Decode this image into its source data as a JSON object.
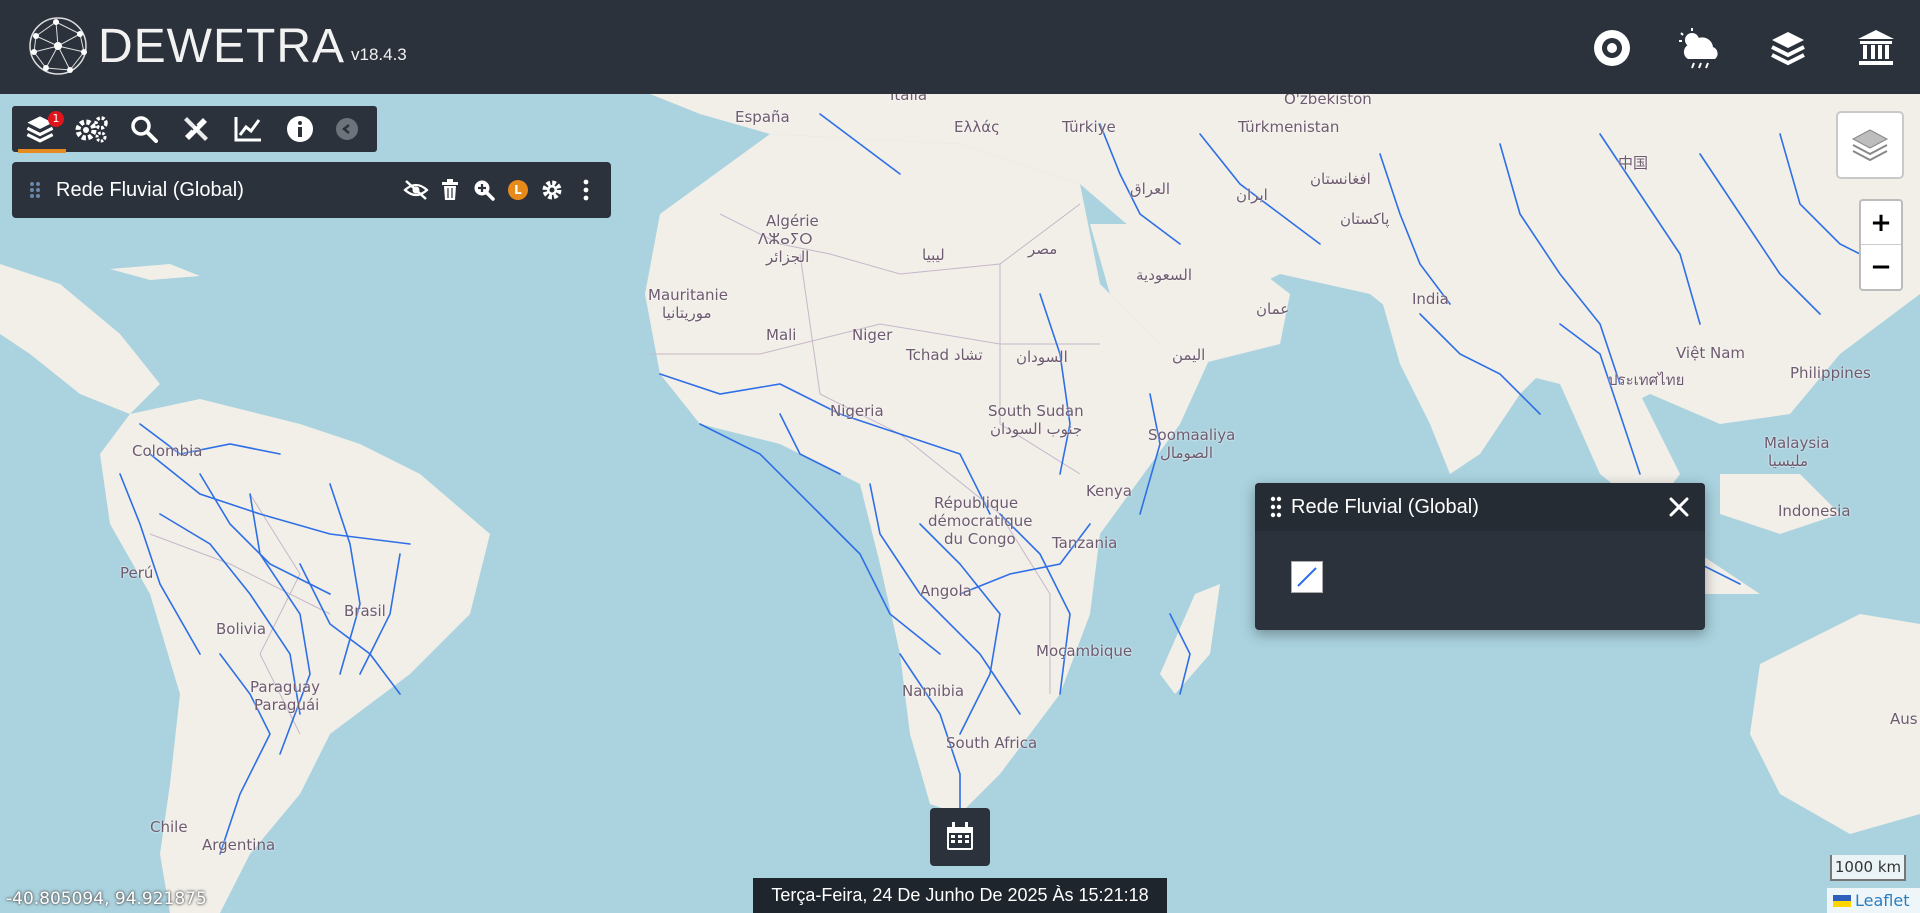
{
  "header": {
    "app_name": "DEWETRA",
    "version": "v18.4.3",
    "icons": [
      "eye-icon",
      "weather-storm-icon",
      "layers-icon",
      "bank-icon"
    ]
  },
  "toolbar": {
    "layers_badge": "1",
    "buttons": [
      "layers-icon",
      "gears-icon",
      "search-icon",
      "tools-icon",
      "chart-line-icon",
      "info-icon",
      "chevron-left-icon"
    ]
  },
  "layer_row": {
    "name": "Rede Fluvial (Global)",
    "badge": "L"
  },
  "legend": {
    "title": "Rede Fluvial (Global)"
  },
  "map": {
    "labels": [
      "Italia",
      "España",
      "Ελλάς",
      "Türkiye",
      "O'zbekiston",
      "Türkmenistan",
      "中国",
      "Algérie",
      "ⴷⵣⴰⵢⵔ",
      "الجزائر",
      "ليبيا",
      "مصر",
      "العراق",
      "ایران",
      "افغانستان",
      "پاکستان",
      "السعودية",
      "Mauritanie",
      "موريتانيا",
      "Mali",
      "Niger",
      "Tchad تشاد",
      "السودان",
      "اليمن",
      "عمان",
      "India",
      "Việt Nam",
      "Philippines",
      "ประเทศไทย",
      "Nigeria",
      "South Sudan",
      "جنوب السودان",
      "Soomaaliya",
      "الصومال",
      "Malaysia",
      "ملیسیا",
      "Colombia",
      "Kenya",
      "République",
      "démocratique",
      "du Congo",
      "Tanzania",
      "Indonesia",
      "Perú",
      "Brasil",
      "Angola",
      "Bolivia",
      "Moçambique",
      "Paraguay",
      "Paraguái",
      "Namibia",
      "South Africa",
      "Chile",
      "Argentina",
      "Aus"
    ]
  },
  "datetime": "Terça-Feira, 24 De Junho De 2025 Às 15:21:18",
  "coordinates": "-40.805094, 94.921875",
  "scale": "1000 km",
  "attribution": "Leaflet",
  "zoom": {
    "in": "+",
    "out": "−"
  },
  "colors": {
    "header_bg": "#2b323b",
    "water": "#aad3df",
    "land": "#f2efe9",
    "rivers": "#2e6fe6",
    "accent": "#e58a1f",
    "badge": "#e0141d"
  }
}
